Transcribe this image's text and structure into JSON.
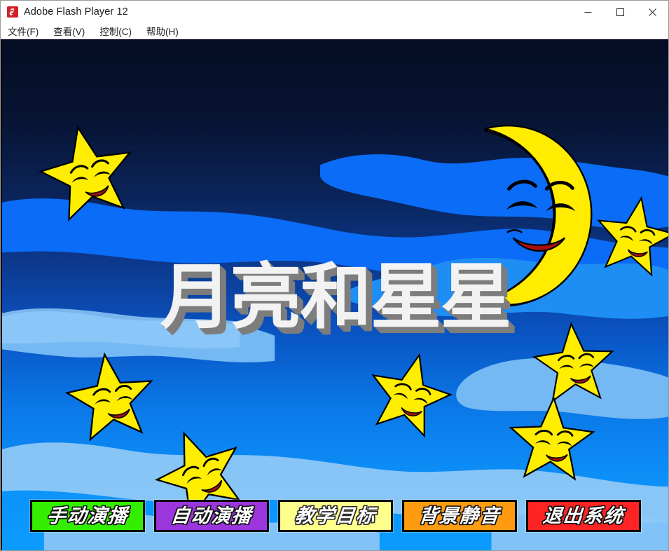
{
  "window": {
    "title": "Adobe Flash Player 12",
    "app_icon": "flash-icon",
    "controls": [
      {
        "name": "minimize",
        "glyph": "minimize-icon"
      },
      {
        "name": "maximize",
        "glyph": "maximize-icon"
      },
      {
        "name": "close",
        "glyph": "close-icon"
      }
    ]
  },
  "menubar": {
    "items": [
      {
        "label": "文件(F)"
      },
      {
        "label": "查看(V)"
      },
      {
        "label": "控制(C)"
      },
      {
        "label": "帮助(H)"
      }
    ]
  },
  "stage": {
    "title": "月亮和星星",
    "title_color": "#f2f2f2",
    "title_shadow_color": "#7d7d7d",
    "sky": {
      "top_color": "#060f28",
      "mid_color": "#0b2f82",
      "bottom_color": "#0d95fa",
      "cloud_bright": "#0b6cf7",
      "cloud_mid": "#1e8ef5",
      "cloud_light": "#74b9f4",
      "cloud_pale": "#8ec8f7"
    },
    "moon": {
      "name": "crescent-moon-character",
      "fill": "#ffec00",
      "outline": "#000000",
      "mouth": "#a81010"
    },
    "stars": [
      {
        "name": "star-top-left",
        "fill": "#ffee00"
      },
      {
        "name": "star-right-upper",
        "fill": "#ffee00"
      },
      {
        "name": "star-left-mid",
        "fill": "#ffee00"
      },
      {
        "name": "star-center",
        "fill": "#ffee00"
      },
      {
        "name": "star-right-mid",
        "fill": "#ffee00"
      },
      {
        "name": "star-bottom-left",
        "fill": "#ffee00"
      },
      {
        "name": "star-bottom-right",
        "fill": "#ffee00"
      }
    ]
  },
  "buttons": [
    {
      "name": "manual-play-button",
      "label": "手动演播",
      "bg": "#33ee00",
      "text_style": "light"
    },
    {
      "name": "auto-play-button",
      "label": "自动演播",
      "bg": "#9b36dd",
      "text_style": "light"
    },
    {
      "name": "teaching-goal-button",
      "label": "教学目标",
      "bg": "#ffff8c",
      "text_style": "dark"
    },
    {
      "name": "mute-background-button",
      "label": "背景静音",
      "bg": "#ff9b11",
      "text_style": "light"
    },
    {
      "name": "exit-system-button",
      "label": "退出系统",
      "bg": "#ff2424",
      "text_style": "light"
    }
  ]
}
